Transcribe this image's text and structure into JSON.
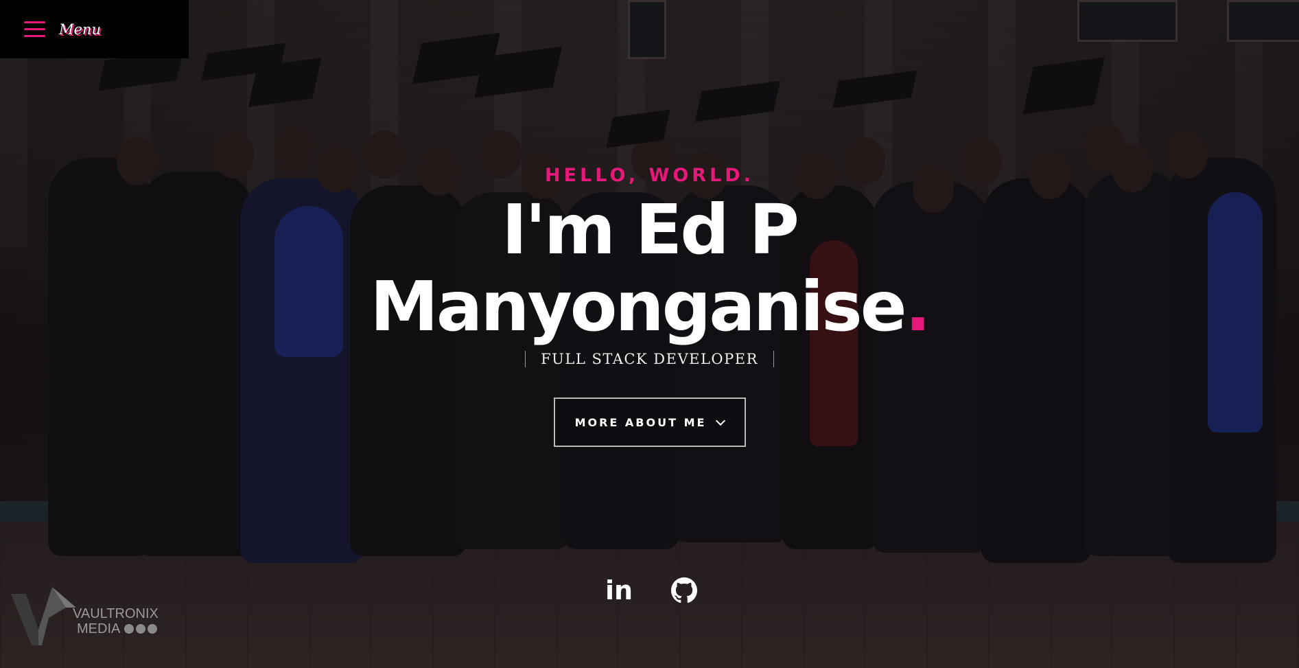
{
  "menu": {
    "label": "Menu"
  },
  "hero": {
    "greeting": "HELLO, WORLD.",
    "name_line1": "I'm Ed P",
    "name_line2": "Manyonganise",
    "name_period": ".",
    "role": "FULL STACK DEVELOPER",
    "cta_label": "MORE ABOUT ME"
  },
  "socials": {
    "linkedin_label": "in"
  },
  "watermark": {
    "line1": "VAULTRONIX",
    "line2": "MEDIA"
  },
  "colors": {
    "accent": "#e6197a",
    "text": "#ffffff",
    "menu_bg": "#000000"
  },
  "icons": [
    "hamburger-menu-icon",
    "chevron-down-icon",
    "linkedin-icon",
    "github-icon"
  ]
}
